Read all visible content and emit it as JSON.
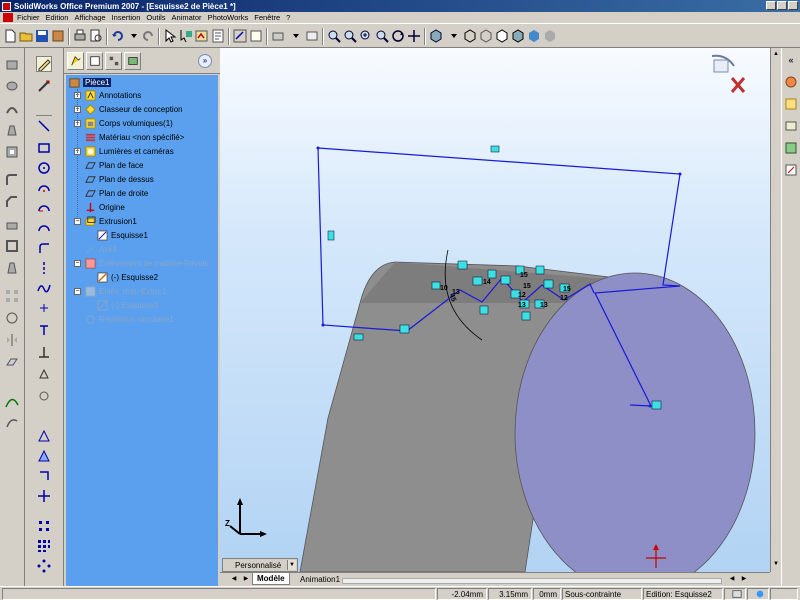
{
  "window": {
    "title": "SolidWorks Office Premium 2007 - [Esquisse2 de Pièce1 *]"
  },
  "menu": [
    "Fichier",
    "Edition",
    "Affichage",
    "Insertion",
    "Outils",
    "Animator",
    "PhotoWorks",
    "Fenêtre",
    "?"
  ],
  "feature_tree": {
    "root": "Pièce1",
    "items": [
      {
        "label": "Annotations"
      },
      {
        "label": "Classeur de conception"
      },
      {
        "label": "Corps volumiques(1)"
      },
      {
        "label": "Matériau <non spécifié>"
      },
      {
        "label": "Lumières et caméras"
      },
      {
        "label": "Plan de face"
      },
      {
        "label": "Plan de dessus"
      },
      {
        "label": "Plan de droite"
      },
      {
        "label": "Origine"
      },
      {
        "label": "Extrusion1"
      },
      {
        "label": "Esquisse1"
      },
      {
        "label": "Axe1"
      },
      {
        "label": "Enlèvement de matière-Révolu"
      },
      {
        "label": "(-) Esquisse2"
      },
      {
        "label": "Enlèv. mat.-Extru.1"
      },
      {
        "label": "(-) Esquisse3"
      },
      {
        "label": "Répétition circulaire1"
      }
    ]
  },
  "viewport": {
    "dimensions": [
      "10",
      "14",
      "13",
      "15",
      "12",
      "13",
      "13",
      "15",
      "15",
      "12",
      "45"
    ],
    "triad_label": "Z",
    "view_orientation_label": "Personnalisé"
  },
  "bottom_tabs": [
    "Modèle",
    "Animation1"
  ],
  "status": {
    "x": "-2.04mm",
    "y": "3.15mm",
    "z": "0mm",
    "state": "Sous-contrainte",
    "mode": "Edition: Esquisse2"
  },
  "colors": {
    "tree_bg": "#5aa0ee",
    "sketch_line": "#1a1ad8",
    "part_gray": "#8e8e8e",
    "part_face": "#8e8fc6",
    "titlebar": "#0a246a"
  }
}
